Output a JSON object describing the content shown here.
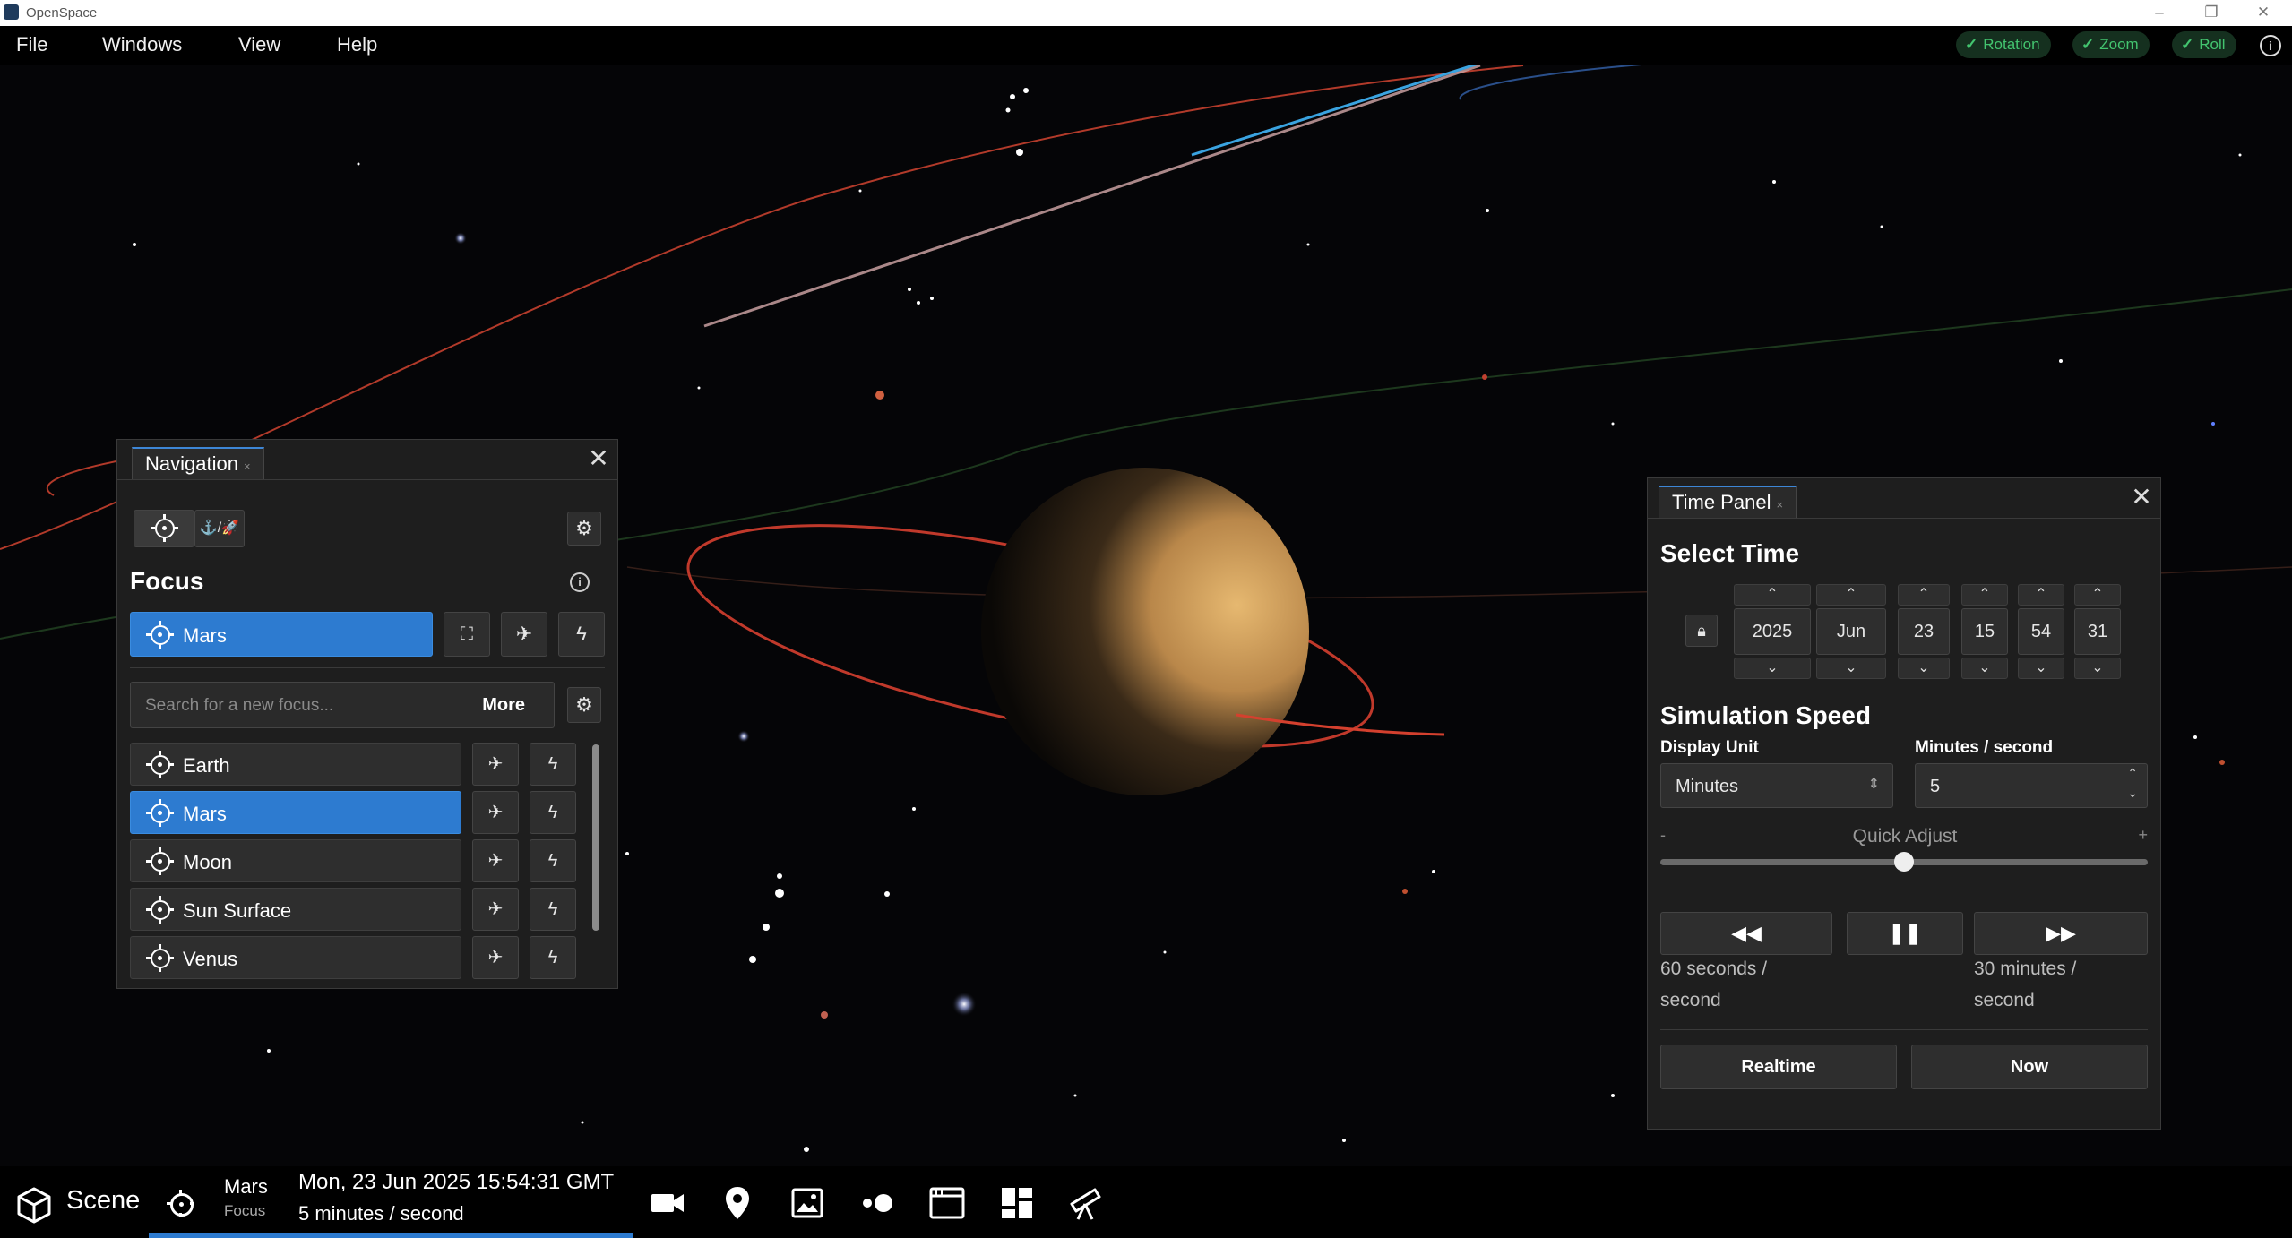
{
  "window": {
    "title": "OpenSpace",
    "minimize": "–",
    "maximize": "❐",
    "close": "✕"
  },
  "menu": {
    "items": [
      "File",
      "Windows",
      "View",
      "Help"
    ],
    "toggles": [
      {
        "label": "Rotation"
      },
      {
        "label": "Zoom"
      },
      {
        "label": "Roll"
      }
    ],
    "info": "i"
  },
  "navigation": {
    "tab_label": "Navigation",
    "tab_close": "×",
    "close": "✕",
    "mode_label": "⚓/🚀",
    "heading": "Focus",
    "info": "i",
    "current_focus": "Mars",
    "search_placeholder": "Search for a new focus...",
    "more_label": "More",
    "items": [
      {
        "label": "Earth",
        "selected": false
      },
      {
        "label": "Mars",
        "selected": true
      },
      {
        "label": "Moon",
        "selected": false
      },
      {
        "label": "Sun Surface",
        "selected": false
      },
      {
        "label": "Venus",
        "selected": false
      }
    ]
  },
  "time_panel": {
    "tab_label": "Time Panel",
    "tab_close": "×",
    "close": "✕",
    "heading": "Select Time",
    "fields": [
      "2025",
      "Jun",
      "23",
      "15",
      "54",
      "31"
    ],
    "speed_heading": "Simulation Speed",
    "display_unit_label": "Display Unit",
    "display_unit_value": "Minutes",
    "rate_label": "Minutes / second",
    "rate_value": "5",
    "quick_adjust_label": "Quick Adjust",
    "quick_minus": "-",
    "quick_plus": "+",
    "quick_adjust_level": 0.5,
    "rewind_note": "60 seconds / second",
    "forward_note": "30 minutes / second",
    "realtime_label": "Realtime",
    "now_label": "Now"
  },
  "bottom_bar": {
    "scene_label": "Scene",
    "focus_name": "Mars",
    "focus_caption": "Focus",
    "datetime": "Mon, 23 Jun 2025 15:54:31 GMT",
    "rate": "5 minutes / second",
    "tools": [
      "camera-icon",
      "map-pin-icon",
      "image-icon",
      "toggle-icon",
      "window-icon",
      "dashboard-icon",
      "telescope-icon"
    ]
  },
  "colors": {
    "accent": "#2d7bd0",
    "toggle_green": "#43c46f",
    "panel_bg": "#1e1e1e",
    "orbit_red": "#c0392b",
    "orbit_blue": "#3aa3e0"
  }
}
